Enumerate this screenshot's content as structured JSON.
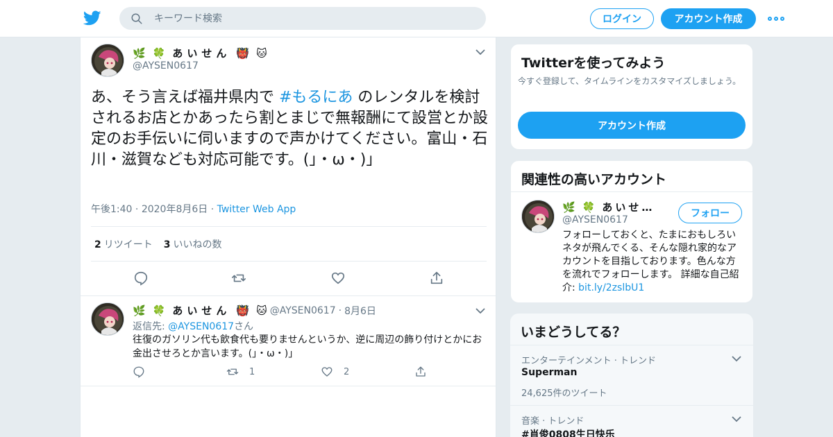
{
  "header": {
    "search_placeholder": "キーワード検索",
    "login_label": "ログイン",
    "signup_label": "アカウント作成"
  },
  "colors": {
    "brand": "#1da1f2",
    "link": "#1b95e0",
    "muted": "#657786",
    "background": "#e6ecf0"
  },
  "tweet": {
    "display_name": "あいせん",
    "handle": "@AYSEN0617",
    "text_before": "あ、そう言えば福井県内で ",
    "hashtag": "#もるにあ",
    "text_after": " のレンタルを検討されるお店とかあったら割とまじで無報酬にて設営とか設定のお手伝いに伺いますので声かけてください。富山・石川・滋賀なども対応可能です。(」・ω・)」",
    "time": "午後1:40",
    "date": "2020年8月6日",
    "via": "Twitter Web App",
    "retweet_count": "2",
    "retweet_label": "リツイート",
    "like_count": "3",
    "like_label": "いいねの数"
  },
  "reply": {
    "display_name": "あいせん",
    "handle": "@AYSEN0617",
    "date": "8月6日",
    "reply_to_prefix": "返信先: ",
    "reply_to_handle": "@AYSEN0617",
    "reply_to_suffix": "さん",
    "text": "往復のガソリン代も飲食代も要りませんというか、逆に周辺の飾り付けとかにお金出させろとか言います。(」・ω・)」",
    "retweet_count": "1",
    "like_count": "2"
  },
  "signup_card": {
    "title": "Twitterを使ってみよう",
    "subtitle": "今すぐ登録して、タイムラインをカスタマイズしましょう。",
    "button_label": "アカウント作成"
  },
  "related_card": {
    "title": "関連性の高いアカウント",
    "display_name": "あいせ…",
    "handle": "@AYSEN0617",
    "follow_label": "フォロー",
    "bio_text": "フォローしておくと、たまにおもしろいネタが飛んでくる、そんな隠れ家的なアカウントを目指しております。色んな方を流れでフォローします。 詳細な自己紹介: ",
    "bio_link": "bit.ly/2zslbU1"
  },
  "trends_card": {
    "title": "いまどうしてる？",
    "items": [
      {
        "category": "エンターテインメント · トレンド",
        "name": "Superman",
        "count": "24,625件のツイート"
      },
      {
        "category": "音楽 · トレンド",
        "name": "#肖俊0808生日快乐",
        "count": ""
      }
    ]
  }
}
